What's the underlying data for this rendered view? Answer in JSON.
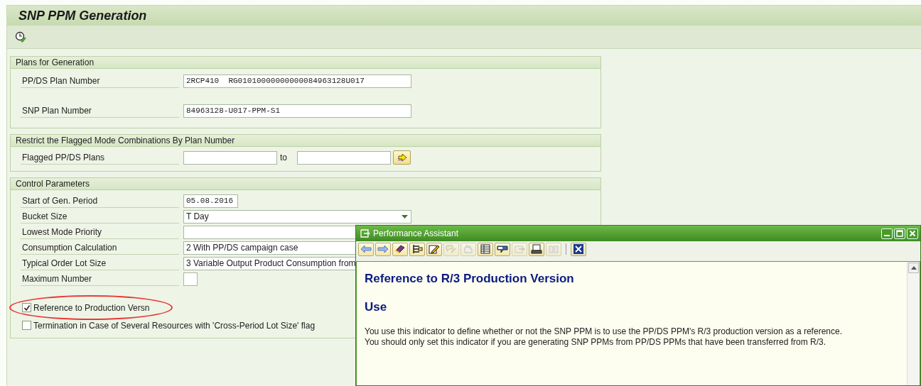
{
  "window": {
    "title": "SNP PPM Generation"
  },
  "toolbar": [
    {
      "kind": "execute"
    }
  ],
  "groups": [
    {
      "title": "Plans for Generation",
      "rows": [
        {
          "kind": "field",
          "label": "PP/DS Plan Number",
          "value": "2RCP410  RG01010000000000084963128U017",
          "mono": true
        },
        {
          "kind": "field",
          "label": "SNP Plan Number",
          "value": "84963128-U017-PPM-S1",
          "mono": true
        }
      ]
    },
    {
      "title": "Restrict the Flagged Mode Combinations By Plan Number",
      "rows": [
        {
          "kind": "range",
          "label": "Flagged PP/DS Plans",
          "to": "to"
        }
      ]
    },
    {
      "title": "Control Parameters",
      "rows": [
        {
          "kind": "date",
          "label": "Start of Gen. Period",
          "value": "05.08.2016",
          "mono": true
        },
        {
          "kind": "dropdown",
          "label": "Bucket Size",
          "value": "T Day"
        },
        {
          "kind": "field",
          "label": "Lowest Mode Priority"
        },
        {
          "kind": "field",
          "label": "Consumption Calculation",
          "value": "2 With PP/DS campaign case"
        },
        {
          "kind": "field",
          "label": "Typical Order Lot Size",
          "value": "3 Variable Output Product Consumption from"
        },
        {
          "kind": "small",
          "label": "Maximum Number"
        },
        {
          "kind": "checkbox",
          "label": "Reference to Production Versn",
          "checked": true,
          "highlighted": true
        },
        {
          "kind": "checkbox",
          "label": "Termination in Case of Several Resources with 'Cross-Period Lot Size' flag",
          "checked": false,
          "highlighted": false
        }
      ]
    }
  ],
  "assistant": {
    "title": "Performance Assistant",
    "tools": [
      {
        "kind": "back",
        "disabled": false
      },
      {
        "kind": "forward",
        "disabled": false
      },
      {
        "kind": "book",
        "disabled": false
      },
      {
        "kind": "structure",
        "disabled": false
      },
      {
        "kind": "edit",
        "disabled": false
      },
      {
        "kind": "comment",
        "disabled": true
      },
      {
        "kind": "hand",
        "disabled": true
      },
      {
        "kind": "table",
        "disabled": false
      },
      {
        "kind": "frame",
        "disabled": false
      },
      {
        "kind": "export",
        "disabled": true
      },
      {
        "kind": "print",
        "disabled": false
      },
      {
        "kind": "find",
        "disabled": true
      },
      {
        "kind": "close",
        "disabled": false
      }
    ],
    "heading": "Reference to R/3 Production Version",
    "subheading": "Use",
    "paragraph": [
      "You use this indicator to define whether or not the SNP PPM is to use the PP/DS PPM's R/3 production version as a reference.",
      "You should only set this indicator if you are generating SNP PPMs from PP/DS PPMs that have been transferred from R/3."
    ]
  }
}
